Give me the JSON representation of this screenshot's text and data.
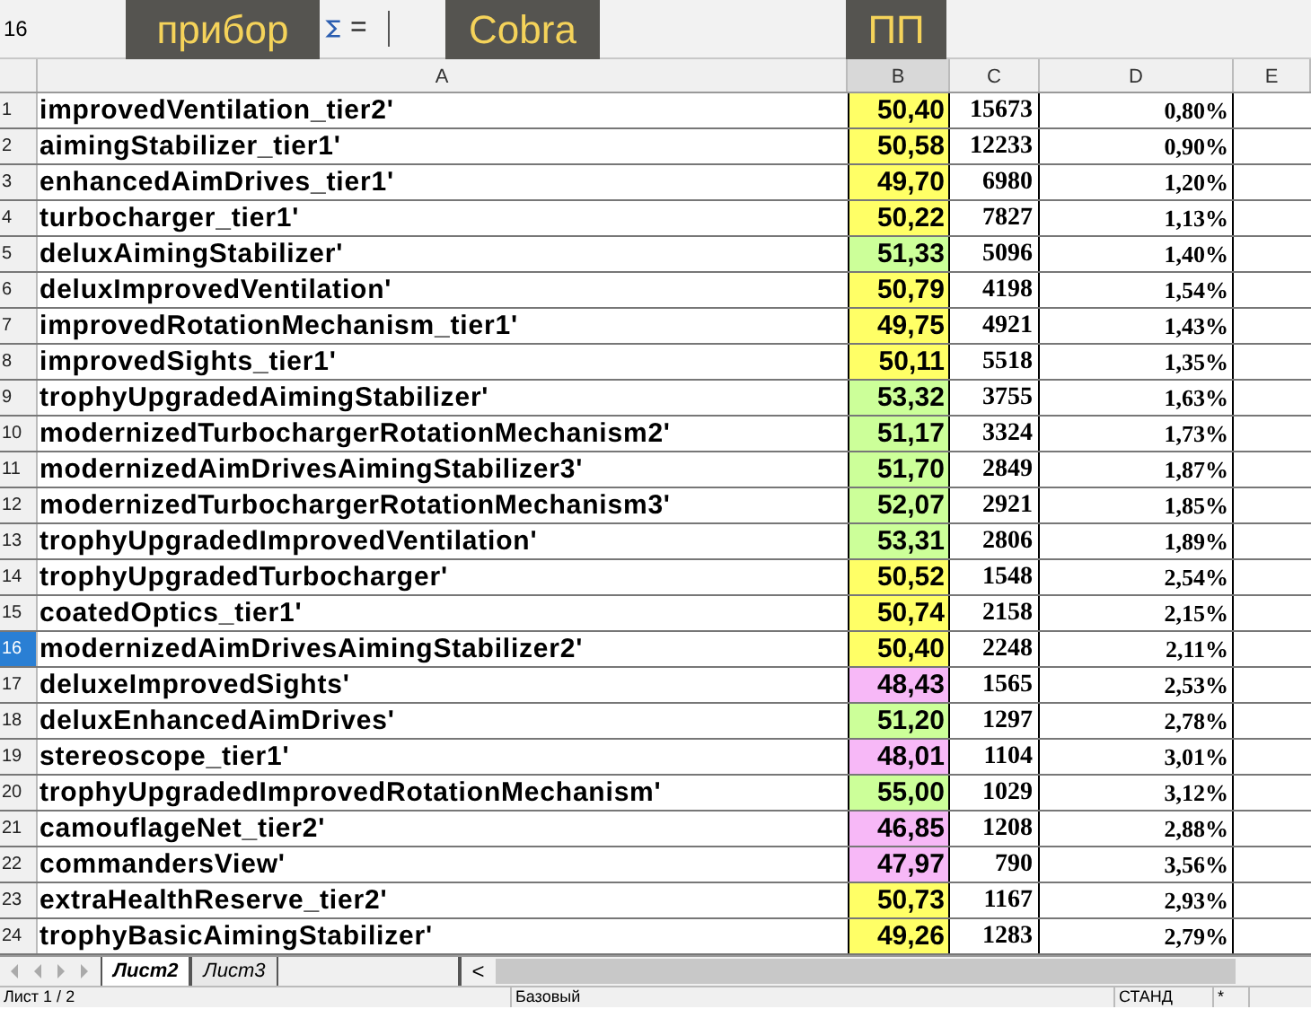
{
  "formula_bar": {
    "name_box": "16",
    "equals": "="
  },
  "overlay_labels": [
    "прибор",
    "Cobra",
    "ПП"
  ],
  "columns": [
    "A",
    "B",
    "C",
    "D",
    "E"
  ],
  "rows": [
    {
      "num": "1",
      "name": "improvedVentilation_tier2'",
      "b": "50,40",
      "color": "#ffff66",
      "c": "15673",
      "d": "0,80%",
      "selected": false
    },
    {
      "num": "2",
      "name": "aimingStabilizer_tier1'",
      "b": "50,58",
      "color": "#ffff66",
      "c": "12233",
      "d": "0,90%",
      "selected": false
    },
    {
      "num": "3",
      "name": "enhancedAimDrives_tier1'",
      "b": "49,70",
      "color": "#ffff66",
      "c": "6980",
      "d": "1,20%",
      "selected": false
    },
    {
      "num": "4",
      "name": "turbocharger_tier1'",
      "b": "50,22",
      "color": "#ffff66",
      "c": "7827",
      "d": "1,13%",
      "selected": false
    },
    {
      "num": "5",
      "name": "deluxAimingStabilizer'",
      "b": "51,33",
      "color": "#ccff99",
      "c": "5096",
      "d": "1,40%",
      "selected": false
    },
    {
      "num": "6",
      "name": "deluxImprovedVentilation'",
      "b": "50,79",
      "color": "#ffff66",
      "c": "4198",
      "d": "1,54%",
      "selected": false
    },
    {
      "num": "7",
      "name": "improvedRotationMechanism_tier1'",
      "b": "49,75",
      "color": "#ffff66",
      "c": "4921",
      "d": "1,43%",
      "selected": false
    },
    {
      "num": "8",
      "name": "improvedSights_tier1'",
      "b": "50,11",
      "color": "#ffff66",
      "c": "5518",
      "d": "1,35%",
      "selected": false
    },
    {
      "num": "9",
      "name": "trophyUpgradedAimingStabilizer'",
      "b": "53,32",
      "color": "#ccff99",
      "c": "3755",
      "d": "1,63%",
      "selected": false
    },
    {
      "num": "10",
      "name": "modernizedTurbochargerRotationMechanism2'",
      "b": "51,17",
      "color": "#ccff99",
      "c": "3324",
      "d": "1,73%",
      "selected": false
    },
    {
      "num": "11",
      "name": "modernizedAimDrivesAimingStabilizer3'",
      "b": "51,70",
      "color": "#ccff99",
      "c": "2849",
      "d": "1,87%",
      "selected": false
    },
    {
      "num": "12",
      "name": "modernizedTurbochargerRotationMechanism3'",
      "b": "52,07",
      "color": "#ccff99",
      "c": "2921",
      "d": "1,85%",
      "selected": false
    },
    {
      "num": "13",
      "name": "trophyUpgradedImprovedVentilation'",
      "b": "53,31",
      "color": "#ccff99",
      "c": "2806",
      "d": "1,89%",
      "selected": false
    },
    {
      "num": "14",
      "name": "trophyUpgradedTurbocharger'",
      "b": "50,52",
      "color": "#ffff66",
      "c": "1548",
      "d": "2,54%",
      "selected": false
    },
    {
      "num": "15",
      "name": "coatedOptics_tier1'",
      "b": "50,74",
      "color": "#ffff66",
      "c": "2158",
      "d": "2,15%",
      "selected": false
    },
    {
      "num": "16",
      "name": "modernizedAimDrivesAimingStabilizer2'",
      "b": "50,40",
      "color": "#ffff66",
      "c": "2248",
      "d": "2,11%",
      "selected": true
    },
    {
      "num": "17",
      "name": "deluxeImprovedSights'",
      "b": "48,43",
      "color": "#f7b8f7",
      "c": "1565",
      "d": "2,53%",
      "selected": false
    },
    {
      "num": "18",
      "name": "deluxEnhancedAimDrives'",
      "b": "51,20",
      "color": "#ccff99",
      "c": "1297",
      "d": "2,78%",
      "selected": false
    },
    {
      "num": "19",
      "name": "stereoscope_tier1'",
      "b": "48,01",
      "color": "#f7b8f7",
      "c": "1104",
      "d": "3,01%",
      "selected": false
    },
    {
      "num": "20",
      "name": "trophyUpgradedImprovedRotationMechanism'",
      "b": "55,00",
      "color": "#ccff99",
      "c": "1029",
      "d": "3,12%",
      "selected": false
    },
    {
      "num": "21",
      "name": "camouflageNet_tier2'",
      "b": "46,85",
      "color": "#f7b8f7",
      "c": "1208",
      "d": "2,88%",
      "selected": false
    },
    {
      "num": "22",
      "name": "commandersView'",
      "b": "47,97",
      "color": "#f7b8f7",
      "c": "790",
      "d": "3,56%",
      "selected": false
    },
    {
      "num": "23",
      "name": "extraHealthReserve_tier2'",
      "b": "50,73",
      "color": "#ffff66",
      "c": "1167",
      "d": "2,93%",
      "selected": false
    },
    {
      "num": "24",
      "name": "trophyBasicAimingStabilizer'",
      "b": "49,26",
      "color": "#ffff66",
      "c": "1283",
      "d": "2,79%",
      "selected": false
    }
  ],
  "sheet_tabs": [
    {
      "label": "Лист2",
      "selected": true
    },
    {
      "label": "Лист3",
      "selected": false
    }
  ],
  "scroll_left": "<",
  "status_bar": [
    "Лист 1 / 2",
    "Базовый",
    "СТАНД",
    "*"
  ]
}
